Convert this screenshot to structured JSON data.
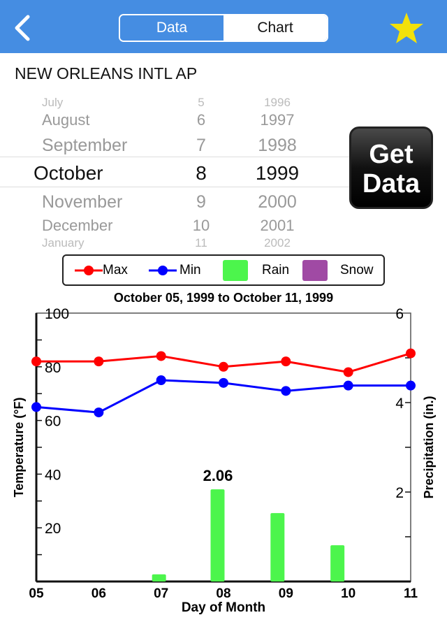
{
  "header": {
    "back_icon": "chevron-left-icon",
    "segments": [
      {
        "label": "Data",
        "selected": true
      },
      {
        "label": "Chart",
        "selected": false
      }
    ],
    "favorite_icon": "star-icon",
    "colors": {
      "bar": "#458de2",
      "star": "#f2e10a"
    }
  },
  "station": "NEW ORLEANS INTL AP",
  "picker": {
    "rows": [
      {
        "month": "July",
        "day": "5",
        "year": "1996"
      },
      {
        "month": "August",
        "day": "6",
        "year": "1997"
      },
      {
        "month": "September",
        "day": "7",
        "year": "1998"
      },
      {
        "month": "October",
        "day": "8",
        "year": "1999"
      },
      {
        "month": "November",
        "day": "9",
        "year": "2000"
      },
      {
        "month": "December",
        "day": "10",
        "year": "2001"
      },
      {
        "month": "January",
        "day": "11",
        "year": "2002"
      }
    ],
    "selected": {
      "month": "October",
      "day": "8",
      "year": "1999"
    }
  },
  "get_data_button": {
    "line1": "Get",
    "line2": "Data"
  },
  "chart_data": {
    "type": "line+bar",
    "title": "October 05, 1999 to October 11, 1999",
    "xlabel": "Day of Month",
    "ylabel": "Temperature (°F)",
    "y2label": "Precipitation (in.)",
    "x": [
      "05",
      "06",
      "07",
      "08",
      "09",
      "10",
      "11"
    ],
    "ylim": [
      0,
      100
    ],
    "y2lim": [
      0,
      6
    ],
    "yticks": [
      "20",
      "40",
      "60",
      "80",
      "100"
    ],
    "y2ticks": [
      "2",
      "4",
      "6"
    ],
    "legend": {
      "placement": "top",
      "entries": [
        "Max",
        "Min",
        "Rain",
        "Snow"
      ]
    },
    "series": [
      {
        "name": "Max",
        "type": "line",
        "color": "#ff0000",
        "values": [
          82,
          82,
          84,
          80,
          82,
          78,
          85
        ]
      },
      {
        "name": "Min",
        "type": "line",
        "color": "#0000ff",
        "values": [
          65,
          63,
          75,
          74,
          71,
          73,
          73
        ]
      },
      {
        "name": "Rain",
        "type": "bar",
        "axis": "y2",
        "color": "#4cf54c",
        "x": [
          "07",
          "08",
          "09",
          "10"
        ],
        "values": [
          0.16,
          2.06,
          1.53,
          0.81
        ]
      },
      {
        "name": "Snow",
        "type": "bar",
        "axis": "y2",
        "color": "#a04aa4",
        "values": []
      }
    ],
    "annotations": [
      {
        "x": "08",
        "text": "2.06"
      }
    ]
  }
}
